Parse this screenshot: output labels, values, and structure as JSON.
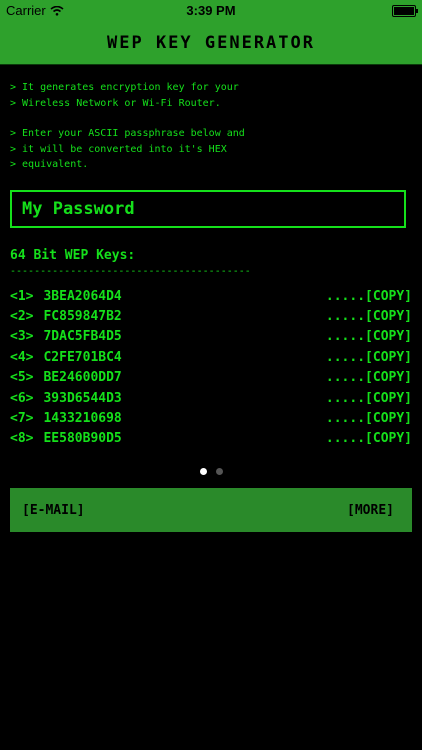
{
  "status_bar": {
    "carrier": "Carrier",
    "time": "3:39 PM"
  },
  "nav": {
    "title": "WEP KEY GENERATOR"
  },
  "intro": {
    "lines_1": [
      "> It generates encryption key for your",
      "> Wireless Network or Wi-Fi Router."
    ],
    "lines_2": [
      "> Enter your ASCII passphrase below and",
      "> it will be converted into it's HEX",
      "> equivalent."
    ]
  },
  "input": {
    "value": "My Password"
  },
  "keys": {
    "title": "64 Bit WEP Keys:",
    "divider": "----------------------------------------",
    "copy_label": ".....[COPY]",
    "items": [
      {
        "index": "<1>",
        "key": "3BEA2064D4"
      },
      {
        "index": "<2>",
        "key": "FC859847B2"
      },
      {
        "index": "<3>",
        "key": "7DAC5FB4D5"
      },
      {
        "index": "<4>",
        "key": "C2FE701BC4"
      },
      {
        "index": "<5>",
        "key": "BE24600DD7"
      },
      {
        "index": "<6>",
        "key": "393D6544D3"
      },
      {
        "index": "<7>",
        "key": "1433210698"
      },
      {
        "index": "<8>",
        "key": "EE580B90D5"
      }
    ]
  },
  "pager": {
    "page_count": 2,
    "active_page": 1
  },
  "bottom": {
    "email_label": "[E-MAIL]",
    "more_label": "[MORE]"
  },
  "colors": {
    "accent": "#2ea12c",
    "text_green": "#15e01b",
    "background": "#000000"
  }
}
